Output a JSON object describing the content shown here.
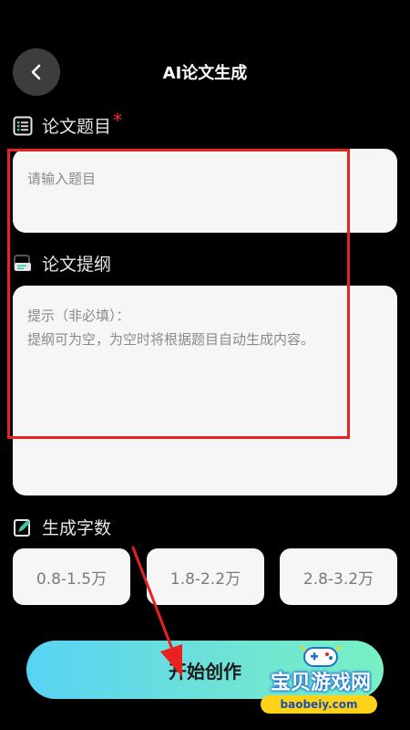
{
  "header": {
    "title": "AI论文生成"
  },
  "topic": {
    "label": "论文题目",
    "required_mark": "*",
    "placeholder": "请输入题目"
  },
  "outline": {
    "label": "论文提纲",
    "hint_line1": "提示（非必填）：",
    "hint_line2": "提纲可为空，为空时将根据题目自动生成内容。"
  },
  "word_count": {
    "label": "生成字数",
    "options": [
      "0.8-1.5万",
      "1.8-2.2万",
      "2.8-3.2万"
    ]
  },
  "start_button": {
    "label": "开始创作"
  },
  "watermark": {
    "text": "宝贝游戏网",
    "url": "baobeiy.com"
  },
  "colors": {
    "background": "#000000",
    "panel": "#f6f6f6",
    "highlight": "#e8231f",
    "gradient_start": "#58d3f4",
    "gradient_end": "#78f0c4",
    "required": "#ff2d2d"
  },
  "icons": [
    "back-arrow-icon",
    "list-icon",
    "outline-icon",
    "edit-icon",
    "gamepad-icon"
  ]
}
